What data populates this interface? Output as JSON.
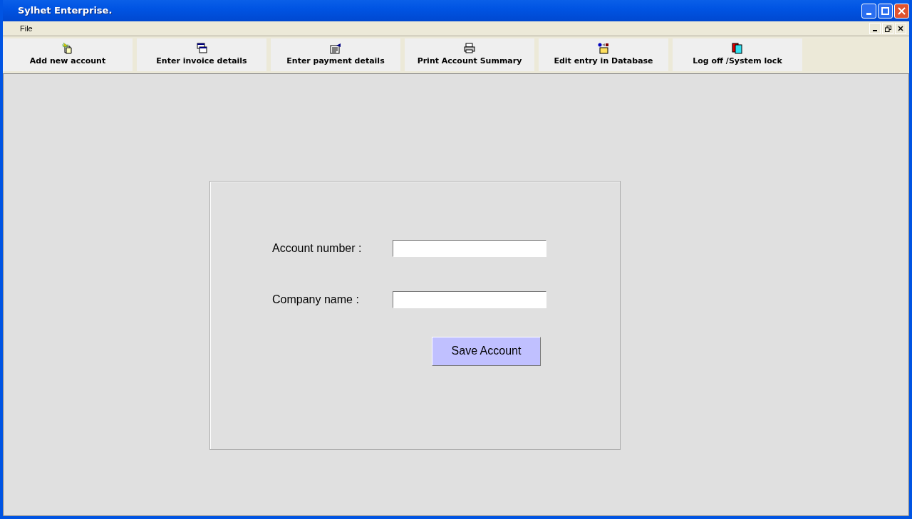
{
  "window": {
    "title": "Sylhet Enterprise."
  },
  "menu": [
    "File"
  ],
  "toolbar": [
    {
      "label": "Add new account",
      "kind": "new"
    },
    {
      "label": "Enter invoice details",
      "kind": "windows"
    },
    {
      "label": "Enter payment details",
      "kind": "form"
    },
    {
      "label": "Print Account Summary",
      "kind": "printer"
    },
    {
      "label": "Edit entry in Database",
      "kind": "box"
    },
    {
      "label": "Log off /System lock",
      "kind": "lock"
    }
  ],
  "form": {
    "fields": [
      {
        "label": "Account number :"
      },
      {
        "label": "Company name :"
      }
    ],
    "button": "Save Account"
  }
}
